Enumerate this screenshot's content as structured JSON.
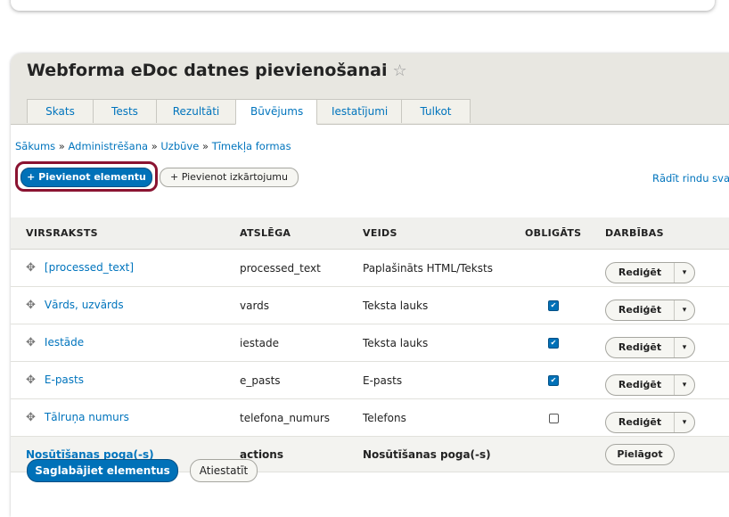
{
  "page": {
    "title": "Webforma eDoc datnes pievienošanai",
    "star": "☆"
  },
  "tabs": [
    {
      "label": "Skats"
    },
    {
      "label": "Tests"
    },
    {
      "label": "Rezultāti"
    },
    {
      "label": "Būvējums",
      "active": true
    },
    {
      "label": "Iestatījumi"
    },
    {
      "label": "Tulkot"
    }
  ],
  "breadcrumb": {
    "items": [
      "Sākums",
      "Administrēšana",
      "Uzbūve",
      "Tīmekļa formas"
    ],
    "separator": "»"
  },
  "toolbar": {
    "add_element": "+ Pievienot elementu",
    "add_layout": "+ Pievienot izkārtojumu",
    "show_weights": "Rādīt rindu sva"
  },
  "table": {
    "headers": [
      "VIRSRAKSTS",
      "ATSLĒGA",
      "VEIDS",
      "OBLIGĀTS",
      "DARBĪBAS"
    ],
    "rows": [
      {
        "title": "[processed_text]",
        "key": "processed_text",
        "type": "Paplašināts HTML/Teksts",
        "required": null,
        "action": "Rediģēt"
      },
      {
        "title": "Vārds, uzvārds",
        "key": "vards",
        "type": "Teksta lauks",
        "required": true,
        "action": "Rediģēt"
      },
      {
        "title": "Iestāde",
        "key": "iestade",
        "type": "Teksta lauks",
        "required": true,
        "action": "Rediģēt"
      },
      {
        "title": "E-pasts",
        "key": "e_pasts",
        "type": "E-pasts",
        "required": true,
        "action": "Rediģēt"
      },
      {
        "title": "Tālruņa numurs",
        "key": "telefona_numurs",
        "type": "Telefons",
        "required": false,
        "action": "Rediģēt"
      }
    ],
    "actions_row": {
      "title": "Nosūtīšanas poga(-s)",
      "key": "actions",
      "type": "Nosūtīšanas poga(-s)",
      "action": "Pielāgot"
    }
  },
  "footer": {
    "save": "Saglabājiet elementus",
    "reset": "Atiestatīt"
  },
  "icons": {
    "drag": "✥",
    "caret": "▾",
    "check": "✔"
  },
  "colors": {
    "accent": "#0071b8",
    "highlight": "#8a1331",
    "header_bg": "#e8e7e1"
  }
}
